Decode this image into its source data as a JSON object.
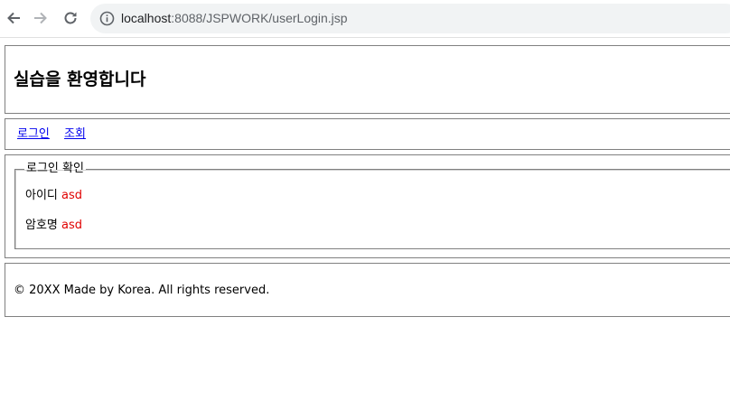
{
  "browser": {
    "url_host": "localhost",
    "url_rest": ":8088/JSPWORK/userLogin.jsp",
    "back_icon": "arrow-left-icon",
    "forward_icon": "arrow-right-icon",
    "reload_icon": "reload-icon",
    "info_icon": "info-icon"
  },
  "header": {
    "title": "실습을 환영합니다"
  },
  "nav": {
    "links": [
      {
        "label": "로그인"
      },
      {
        "label": "조회"
      }
    ]
  },
  "login_confirm": {
    "legend": "로그인 확인",
    "id_label": "아이디",
    "id_value": "asd",
    "pw_label": "암호명",
    "pw_value": "asd"
  },
  "footer": {
    "copyright": "© 20XX Made by Korea. All rights reserved."
  },
  "colors": {
    "link": "#0000ee",
    "value_text": "#e00000",
    "border": "#808080",
    "address_bar_bg": "#f1f3f4"
  }
}
